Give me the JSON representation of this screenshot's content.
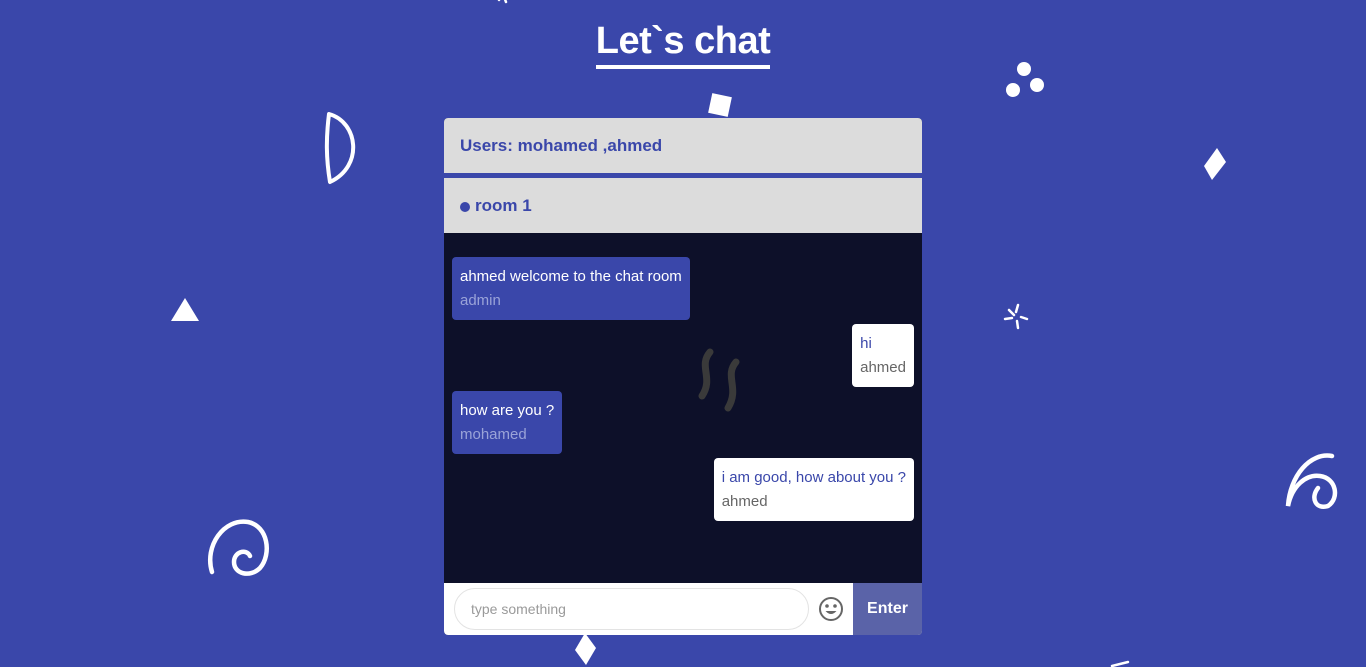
{
  "title": "Let`s chat",
  "users_label": "Users: mohamed ,ahmed",
  "room_label": "room 1",
  "messages": [
    {
      "text": "ahmed welcome to the chat room",
      "author": "admin",
      "direction": "incoming"
    },
    {
      "text": "hi",
      "author": "ahmed",
      "direction": "outgoing"
    },
    {
      "text": "how are you ?",
      "author": "mohamed",
      "direction": "incoming"
    },
    {
      "text": "i am good, how about you ?",
      "author": "ahmed",
      "direction": "outgoing"
    }
  ],
  "input": {
    "placeholder": "type something",
    "value": ""
  },
  "emoji_icon": "smiley-face-icon",
  "enter_label": "Enter",
  "colors": {
    "background": "#3a47aa",
    "panel": "#dcdcdc",
    "chat_bg": "#0d1029",
    "incoming_bubble": "#3a47aa",
    "outgoing_bubble": "#ffffff",
    "enter_button": "#5a63a8"
  }
}
